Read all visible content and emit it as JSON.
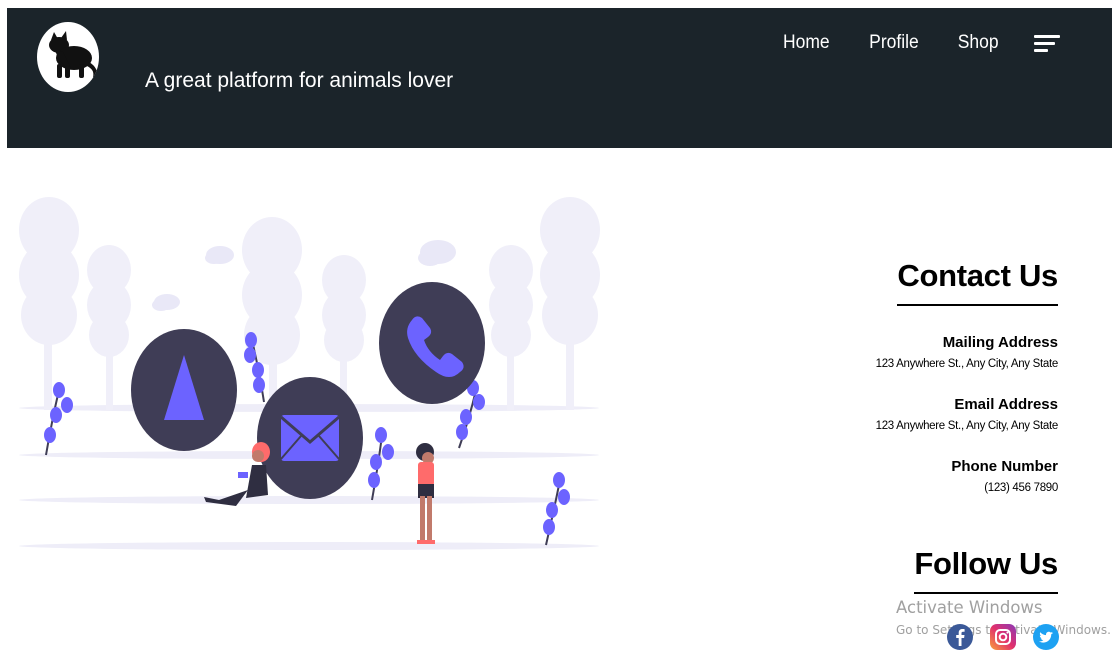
{
  "header": {
    "tagline": "A great platform for animals lover",
    "nav": [
      "Home",
      "Profile",
      "Shop"
    ],
    "logo_icon": "cat-silhouette-icon",
    "menu_icon": "menu-lines-icon"
  },
  "illustration": {
    "icon": "contact-us-illustration",
    "symbols": [
      "navigation-arrow-icon",
      "envelope-icon",
      "phone-icon"
    ]
  },
  "contact": {
    "title": "Contact Us",
    "items": [
      {
        "title": "Mailing Address",
        "value": "123 Anywhere St., Any City, Any State"
      },
      {
        "title": "Email Address",
        "value": "123 Anywhere St., Any City, Any State"
      },
      {
        "title": "Phone Number",
        "value": "(123) 456 7890"
      }
    ]
  },
  "follow": {
    "title": "Follow Us",
    "icons": [
      "facebook-icon",
      "instagram-icon",
      "twitter-icon"
    ]
  },
  "watermark": {
    "title": "Activate Windows",
    "subtitle": "Go to Settings to activate Windows."
  },
  "colors": {
    "header_bg": "#1b242a",
    "accent_purple": "#6c63ff",
    "circle_dark": "#3f3d56",
    "tree_light": "#f0eff9"
  }
}
